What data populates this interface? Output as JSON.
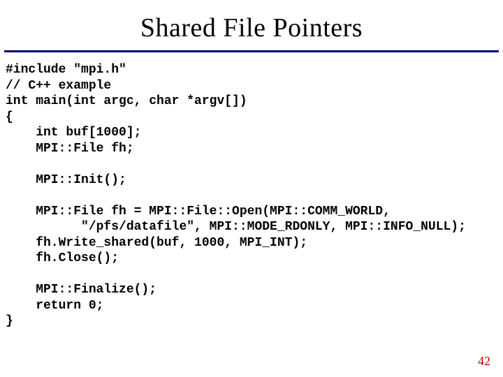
{
  "title": "Shared File Pointers",
  "code": "#include \"mpi.h\"\n// C++ example\nint main(int argc, char *argv[])\n{\n    int buf[1000];\n    MPI::File fh;\n\n    MPI::Init();\n\n    MPI::File fh = MPI::File::Open(MPI::COMM_WORLD,\n          \"/pfs/datafile\", MPI::MODE_RDONLY, MPI::INFO_NULL);\n    fh.Write_shared(buf, 1000, MPI_INT);\n    fh.Close();\n\n    MPI::Finalize();\n    return 0;\n}",
  "page_number": "42"
}
